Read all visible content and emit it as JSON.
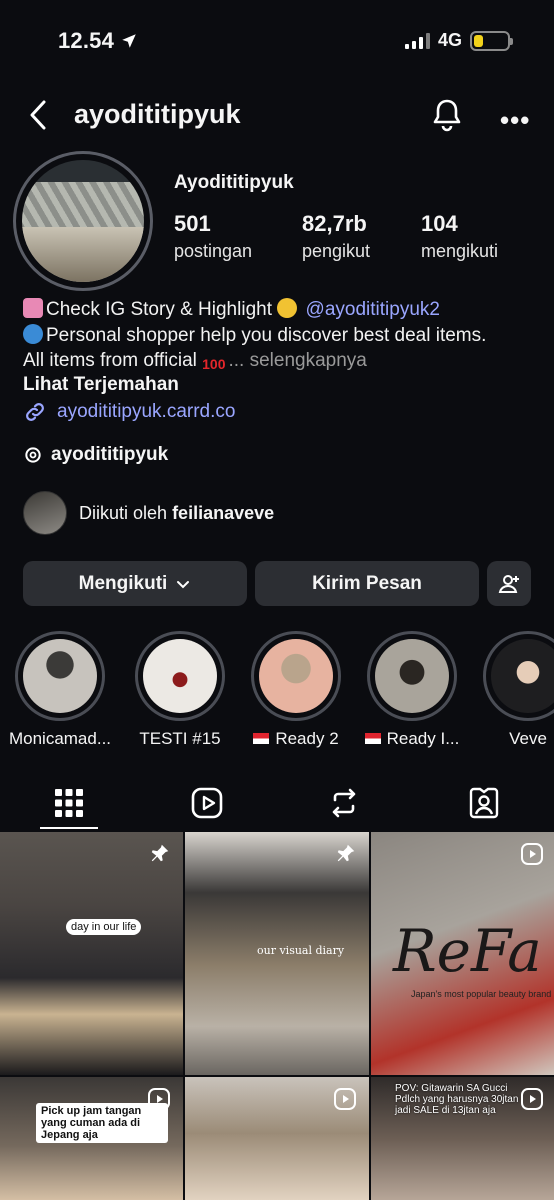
{
  "status": {
    "time": "12.54",
    "network": "4G"
  },
  "header": {
    "username": "ayodititipyuk"
  },
  "profile": {
    "display_name": "Ayodititipyuk",
    "posts": {
      "count": "501",
      "label": "postingan"
    },
    "followers": {
      "count": "82,7rb",
      "label": "pengikut"
    },
    "following": {
      "count": "104",
      "label": "mengikuti"
    }
  },
  "bio": {
    "line1_text": "Check IG Story & Highlight",
    "line1_mention": "@ayodititipyuk2",
    "line2": "Personal shopper help you discover best deal items.",
    "line3": "All items from official",
    "more": "... selengkapnya",
    "translate": "Lihat Terjemahan",
    "link": "ayodititipyuk.carrd.co",
    "threads": "ayodititipyuk"
  },
  "followed_by": {
    "prefix": "Diikuti oleh",
    "name": "feilianaveve"
  },
  "buttons": {
    "follow": "Mengikuti",
    "message": "Kirim Pesan"
  },
  "highlights": [
    {
      "label": "Monicamad..."
    },
    {
      "label": "TESTI #15"
    },
    {
      "label": "Ready 2"
    },
    {
      "label": "Ready I..."
    },
    {
      "label": "Veve"
    }
  ],
  "grid": {
    "post1_caption": "day in our life",
    "post2_caption": "our visual diary",
    "post3_caption": "ReFa",
    "post3_sub": "Japan's most popular beauty brand",
    "post4_caption": "Pick up jam tangan yang cuman ada di Jepang aja",
    "post6_caption": "POV: Gitawarin SA Gucci Pdlch yang harusnya 30jtan jadi SALE di 13jtan aja"
  },
  "colors": {
    "link": "#9aa6ff",
    "button_bg": "#2c2e33",
    "background": "#0b0c10",
    "battery": "#f2d21b"
  }
}
